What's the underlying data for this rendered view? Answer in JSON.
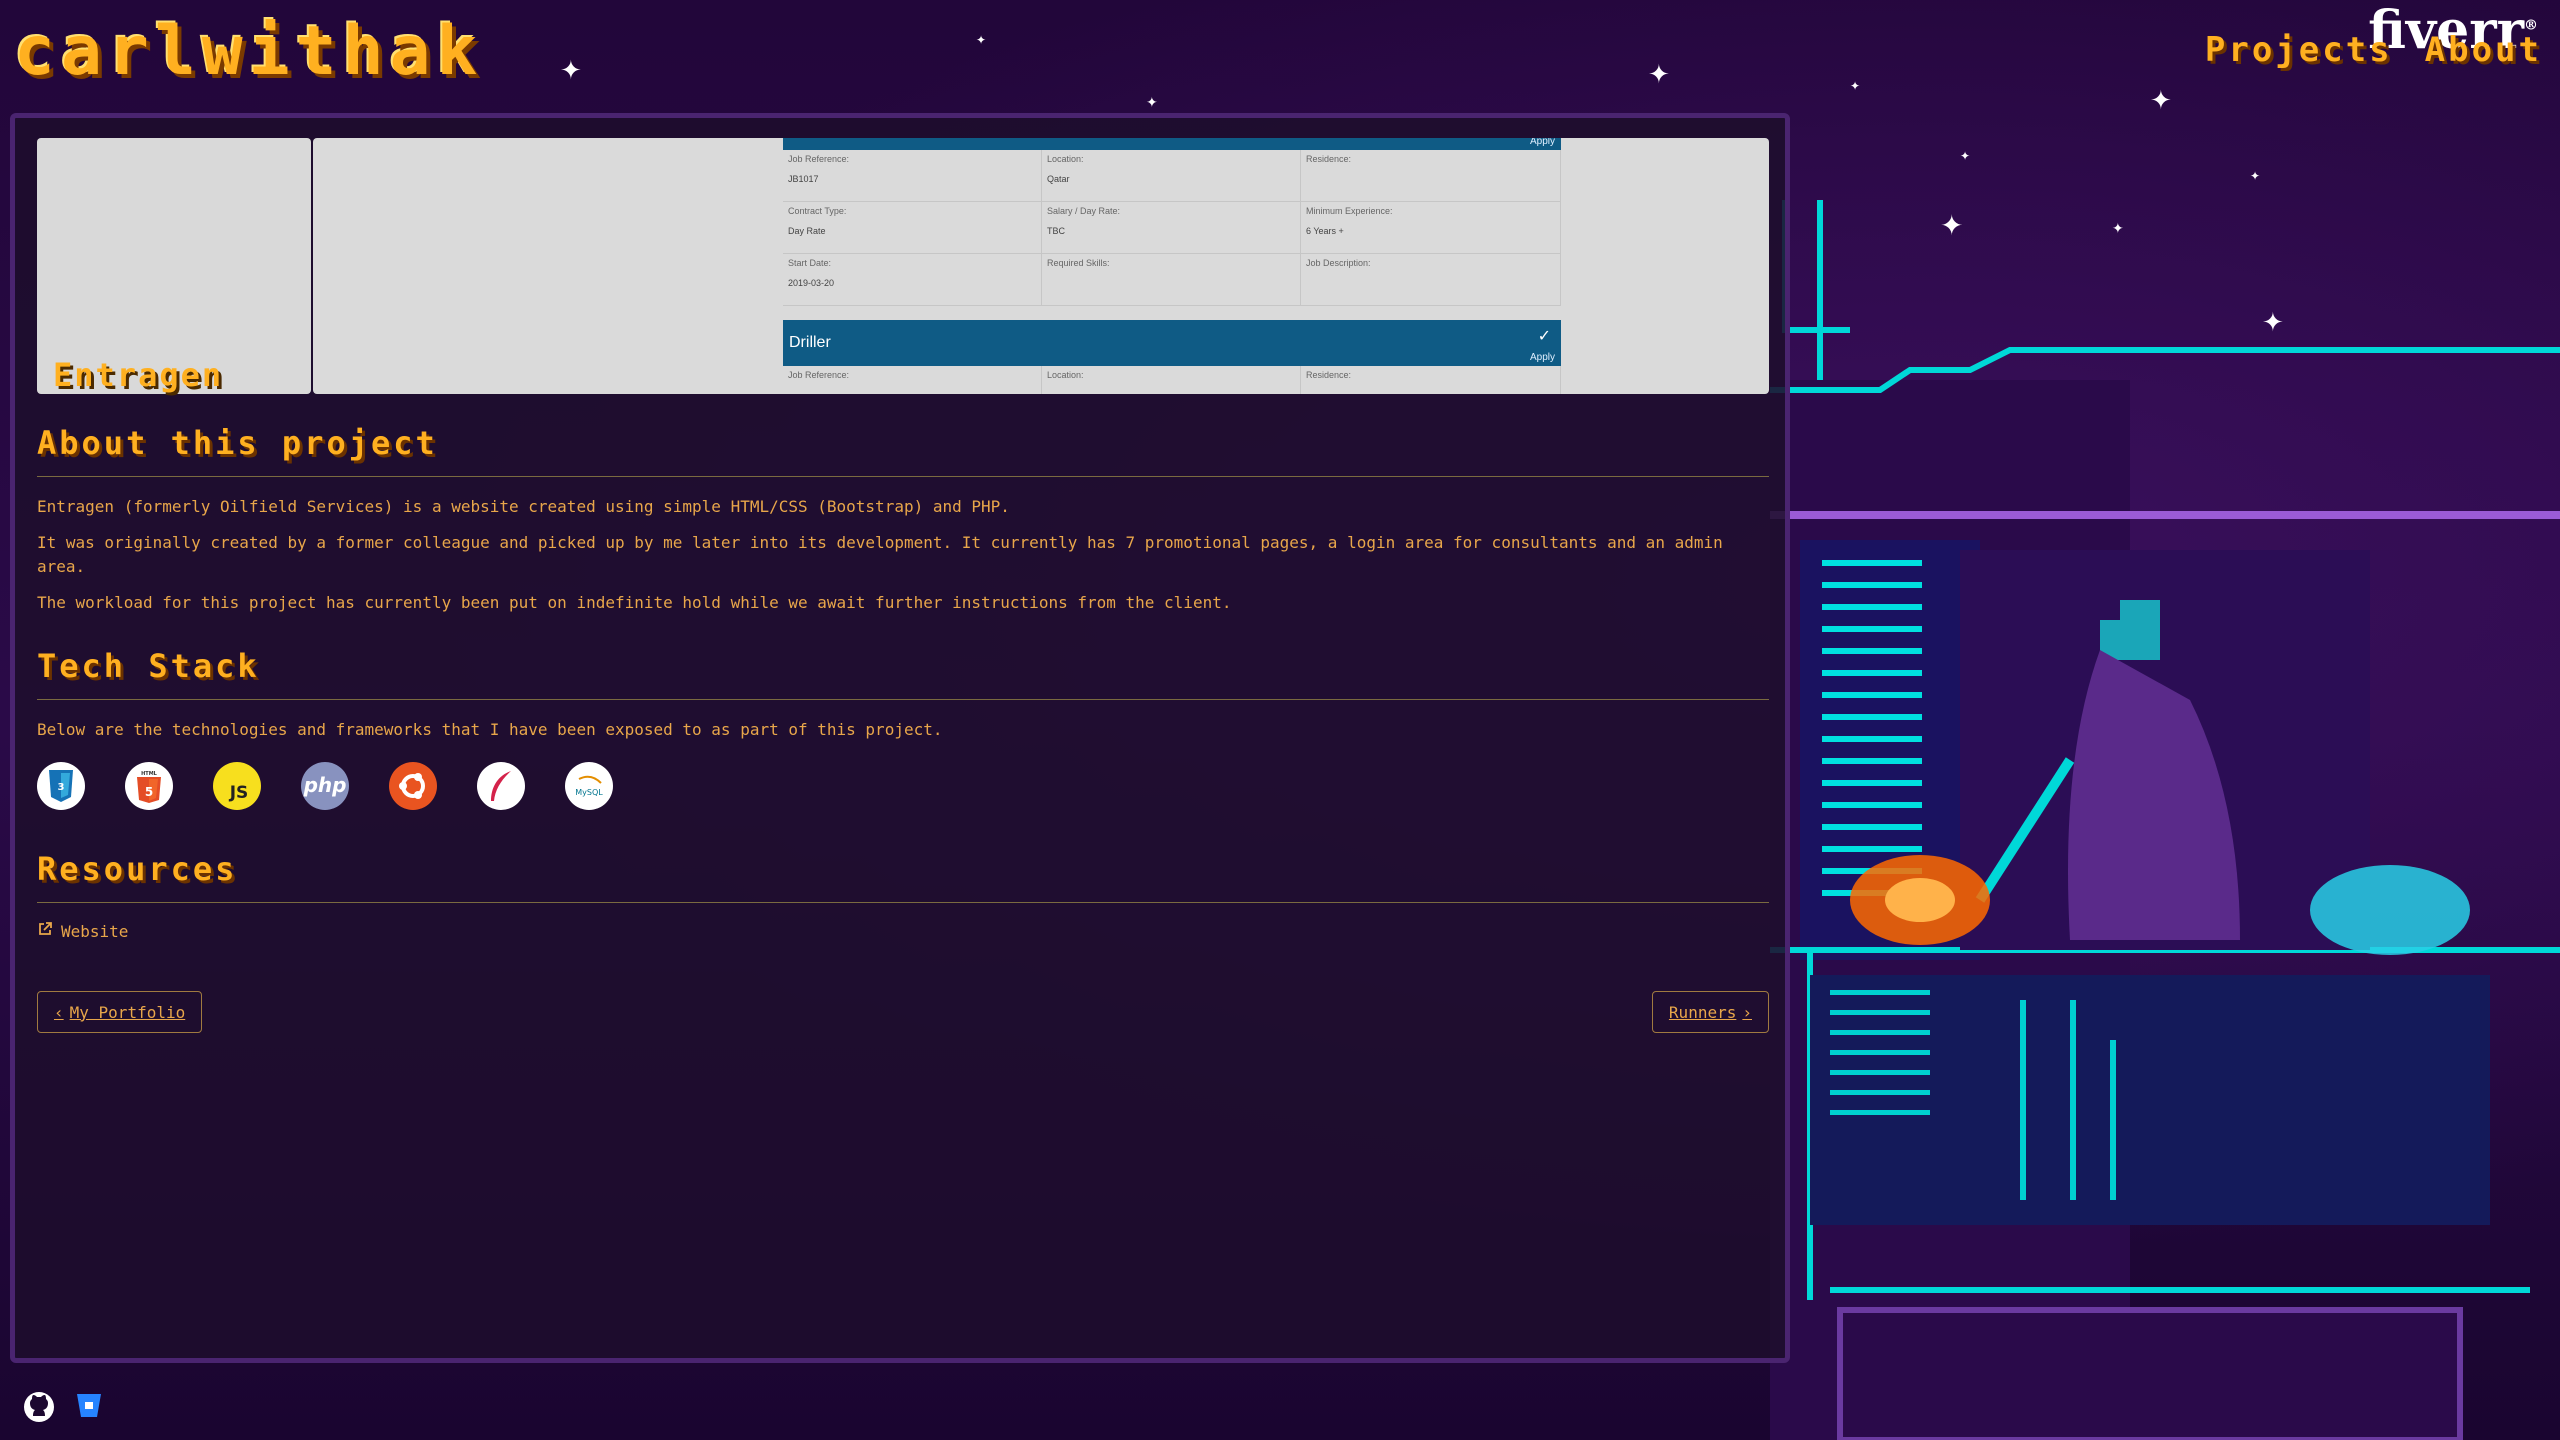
{
  "header": {
    "brand": "carlwithak",
    "nav": [
      "Projects",
      "About"
    ],
    "fiverr_label": "fiverr",
    "fiverr_mark": "®"
  },
  "banner": {
    "title": "Entragen",
    "job_first": {
      "apply": "Apply",
      "cells": [
        {
          "k": "Job Reference:",
          "v": "JB1017"
        },
        {
          "k": "Location:",
          "v": "Qatar"
        },
        {
          "k": "Residence:",
          "v": ""
        },
        {
          "k": "Contract Type:",
          "v": "Day Rate"
        },
        {
          "k": "Salary / Day Rate:",
          "v": "TBC"
        },
        {
          "k": "Minimum Experience:",
          "v": "6 Years +"
        },
        {
          "k": "Start Date:",
          "v": "2019-03-20"
        },
        {
          "k": "Required Skills:",
          "v": ""
        },
        {
          "k": "Job Description:",
          "v": ""
        }
      ]
    },
    "job_second": {
      "title": "Driller",
      "apply": "Apply",
      "cells": [
        {
          "k": "Job Reference:"
        },
        {
          "k": "Location:"
        },
        {
          "k": "Residence:"
        }
      ]
    }
  },
  "about": {
    "heading": "About this project",
    "paragraphs": [
      "Entragen (formerly Oilfield Services) is a website created using simple HTML/CSS (Bootstrap) and PHP.",
      "It was originally created by a former colleague and picked up by me later into its development. It currently has 7 promotional pages, a login area for consultants and an admin area.",
      "The workload for this project has currently been put on indefinite hold while we await further instructions from the client."
    ]
  },
  "tech": {
    "heading": "Tech Stack",
    "intro": "Below are the technologies and frameworks that I have been exposed to as part of this project.",
    "items": [
      {
        "icon": "css3-icon"
      },
      {
        "icon": "html5-icon",
        "label": "HTML"
      },
      {
        "icon": "javascript-icon",
        "label": "JS"
      },
      {
        "icon": "php-icon",
        "label": "php"
      },
      {
        "icon": "ubuntu-icon"
      },
      {
        "icon": "feather-icon"
      },
      {
        "icon": "mysql-icon",
        "label": "MySQL"
      }
    ]
  },
  "resources": {
    "heading": "Resources",
    "link": "Website"
  },
  "nav_buttons": {
    "prev": "My Portfolio",
    "next": "Runners"
  },
  "colors": {
    "accent": "#ffb020",
    "text": "#e8a64a",
    "job_bar": "#0f5b85",
    "panel_border": "#4a2470"
  }
}
